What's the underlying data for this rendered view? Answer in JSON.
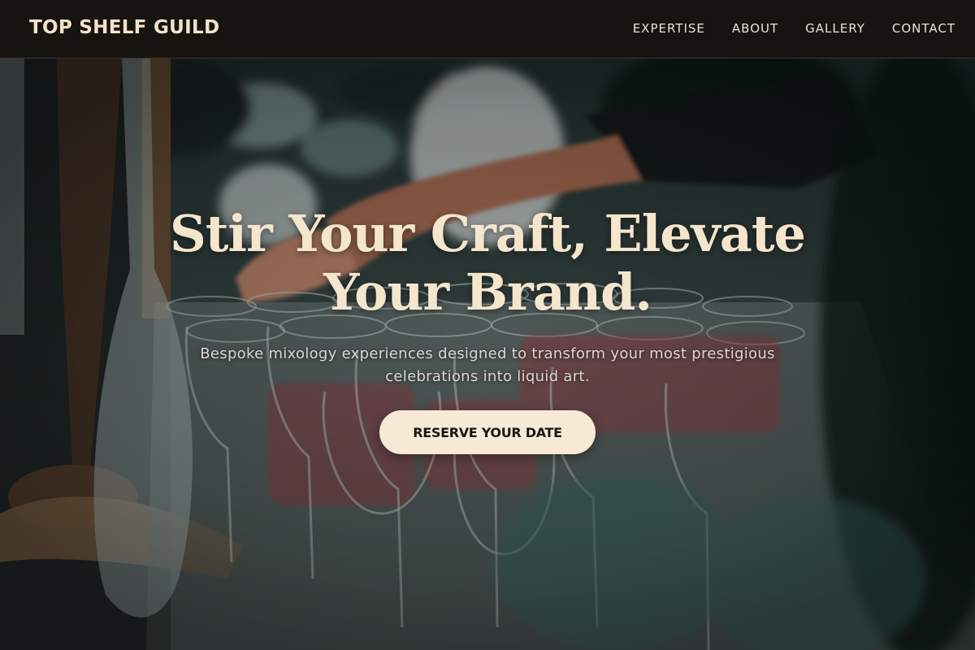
{
  "header": {
    "brand": "TOP SHELF GUILD",
    "nav": [
      "EXPERTISE",
      "ABOUT",
      "GALLERY",
      "CONTACT"
    ]
  },
  "hero": {
    "title_line1": "Stir Your Craft, Elevate",
    "title_line2": "Your Brand.",
    "subtitle_line1": "Bespoke mixology experiences designed to transform your most prestigious",
    "subtitle_line2": "celebrations into liquid art.",
    "cta": "RESERVE YOUR DATE",
    "background": "photo of a bartender reaching over rows of crystal stemware"
  },
  "colors": {
    "header_bg": "#171310",
    "brand": "#f3e3c9",
    "title": "#f4e5cd",
    "cta_bg": "#f7e9d6",
    "cta_text": "#1b1612"
  }
}
